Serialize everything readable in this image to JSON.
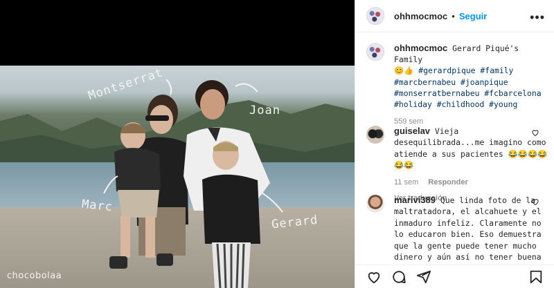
{
  "photo": {
    "labels": {
      "montserrat": "Montserrat",
      "joan": "Joan",
      "marc": "Marc",
      "gerard": "Gerard"
    },
    "watermark": "chocobolaa"
  },
  "header": {
    "username": "ohhmocmoc",
    "separator": "•",
    "follow_label": "Seguir",
    "more_icon": "more-options-icon"
  },
  "caption": {
    "username": "ohhmocmoc",
    "text": "Gerard Piqué's Family",
    "emoji": "😊👍",
    "hashtags": [
      "#gerardpique",
      "#family",
      "#marcbernabeu",
      "#joanpique",
      "#monserratbernabeu",
      "#fcbarcelona",
      "#holiday",
      "#childhood",
      "#young"
    ],
    "time": "559 sem"
  },
  "comments": [
    {
      "username": "guiselav",
      "text": "Vieja desequilibrada...me imagino como atiende a sus pacientes 😂😂😂😂😂😂",
      "time": "11 sem",
      "reply_label": "Responder",
      "translate_label": "Ver traducción"
    },
    {
      "username": "marivi389",
      "text": "Que linda foto de la maltratadora, el alcahuete y el inmaduro infeliz. Claramente no lo educaron bien. Eso demuestra que la gente puede tener mucho dinero y aún así no tener buena"
    }
  ],
  "colors": {
    "link": "#0095f6",
    "hashtag": "#00376b",
    "muted": "#8e8e8e",
    "text": "#262626"
  }
}
